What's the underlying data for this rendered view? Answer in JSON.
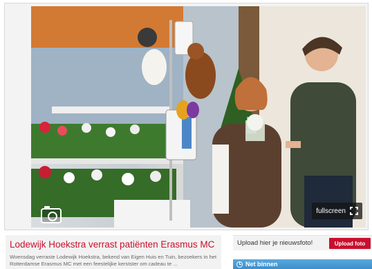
{
  "photo": {
    "alt_description": "",
    "fullscreen_label": "fullscreen"
  },
  "article": {
    "title": "Lodewijk Hoekstra verrast patiënten Erasmus MC",
    "teaser": "Woensdag verraste Lodewijk Hoekstra, bekend van Eigen Huis en Tuin, bezoekers in het Rotterdamse Erasmus MC met een feestelijke kerstster om cadeau te ..."
  },
  "upload": {
    "text": "Upload hier je nieuwsfoto!",
    "button_label": "Upload foto"
  },
  "net_binnen": {
    "label": "Net binnen"
  },
  "colors": {
    "accent_red": "#c8102e",
    "net_binnen_blue": "#3b8fcc"
  },
  "icons": [
    "camera-icon",
    "fullscreen-icon",
    "clock-icon"
  ]
}
